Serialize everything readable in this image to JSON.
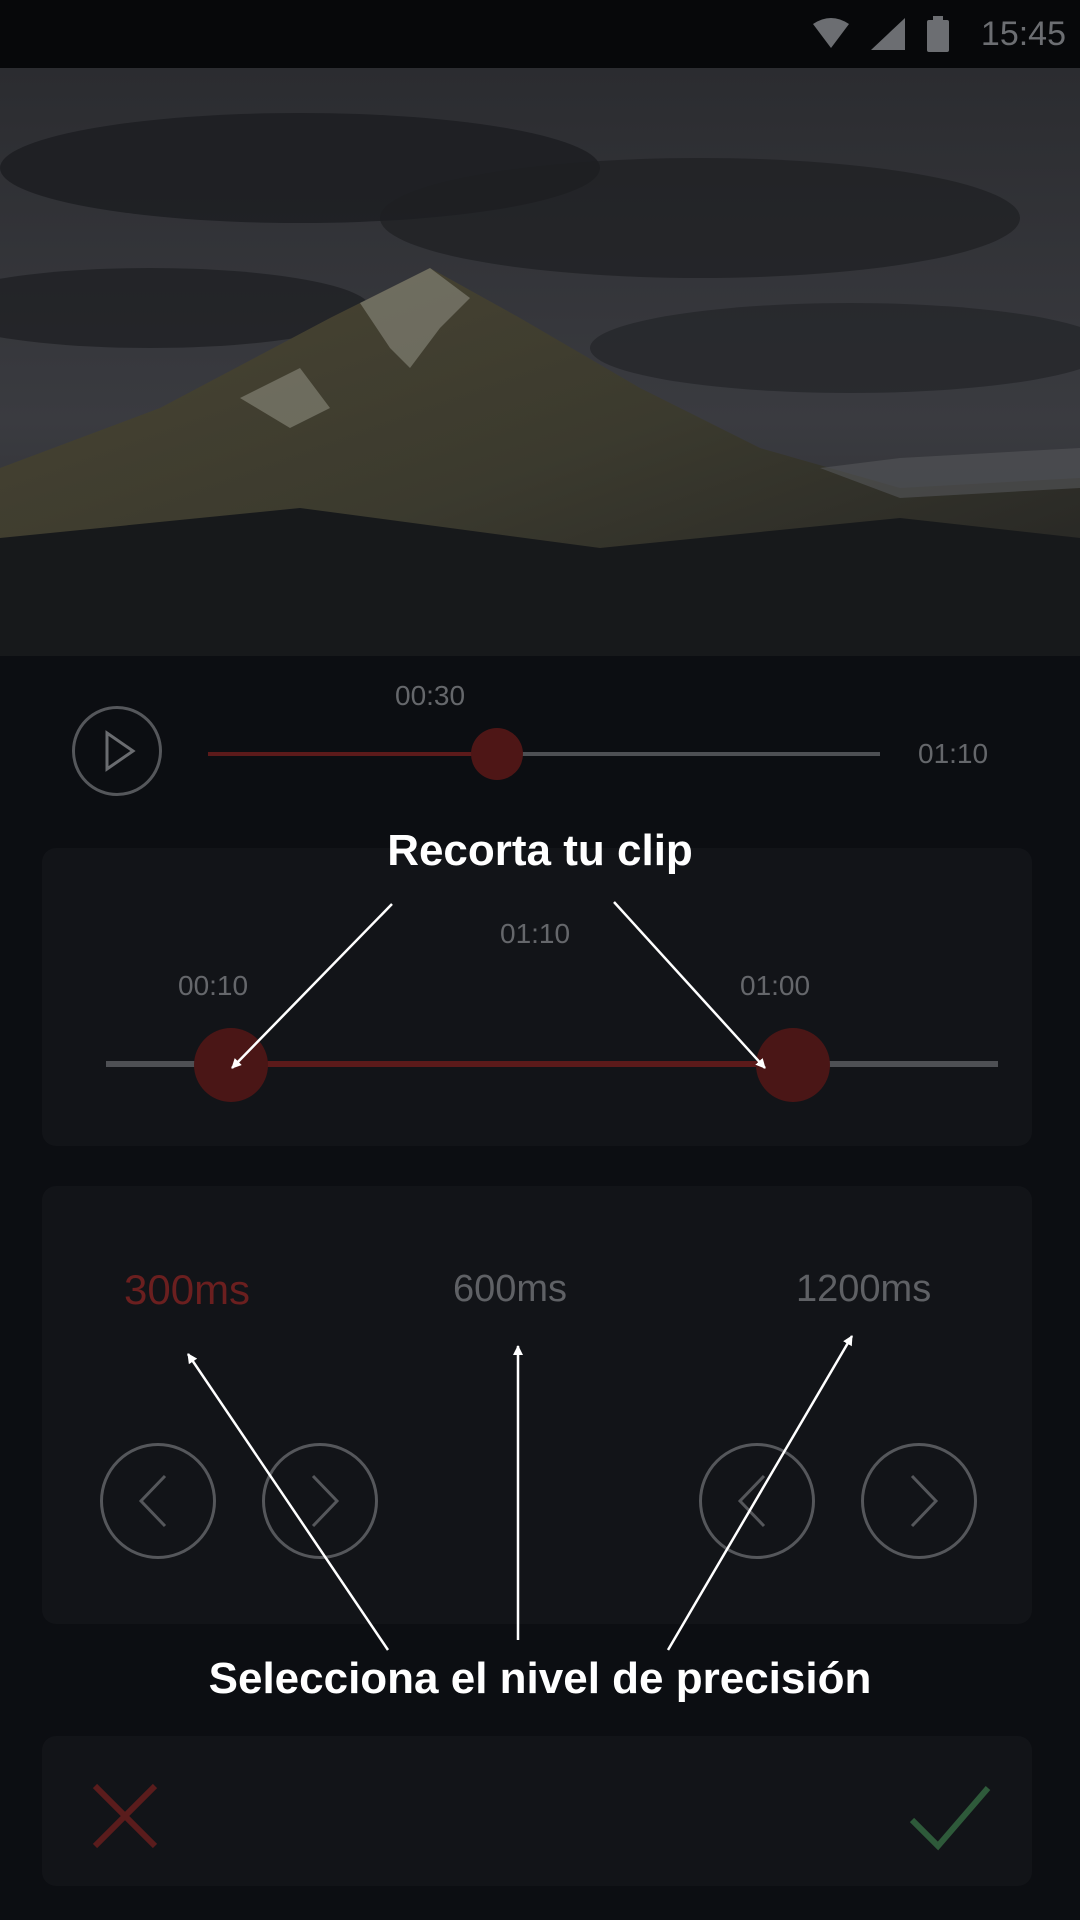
{
  "status_bar": {
    "time": "15:45",
    "icons": [
      "wifi-icon",
      "signal-icon",
      "battery-icon"
    ]
  },
  "player": {
    "current_time": "00:30",
    "total_time": "01:10",
    "progress": 0.43
  },
  "trim": {
    "start_time": "00:10",
    "end_time": "01:00",
    "duration": "01:10",
    "start_fraction": 0.14,
    "end_fraction": 0.77
  },
  "precision": {
    "options": [
      "300ms",
      "600ms",
      "1200ms"
    ],
    "selected": "300ms"
  },
  "annotations": {
    "trim_caption": "Recorta tu clip",
    "precision_caption": "Selecciona el nivel de precisión"
  },
  "colors": {
    "accent_red": "#5c1a1a",
    "selected_text": "#6b1f1f",
    "confirm_green": "#2e5a3a",
    "cancel_red": "#5a1c1c"
  }
}
